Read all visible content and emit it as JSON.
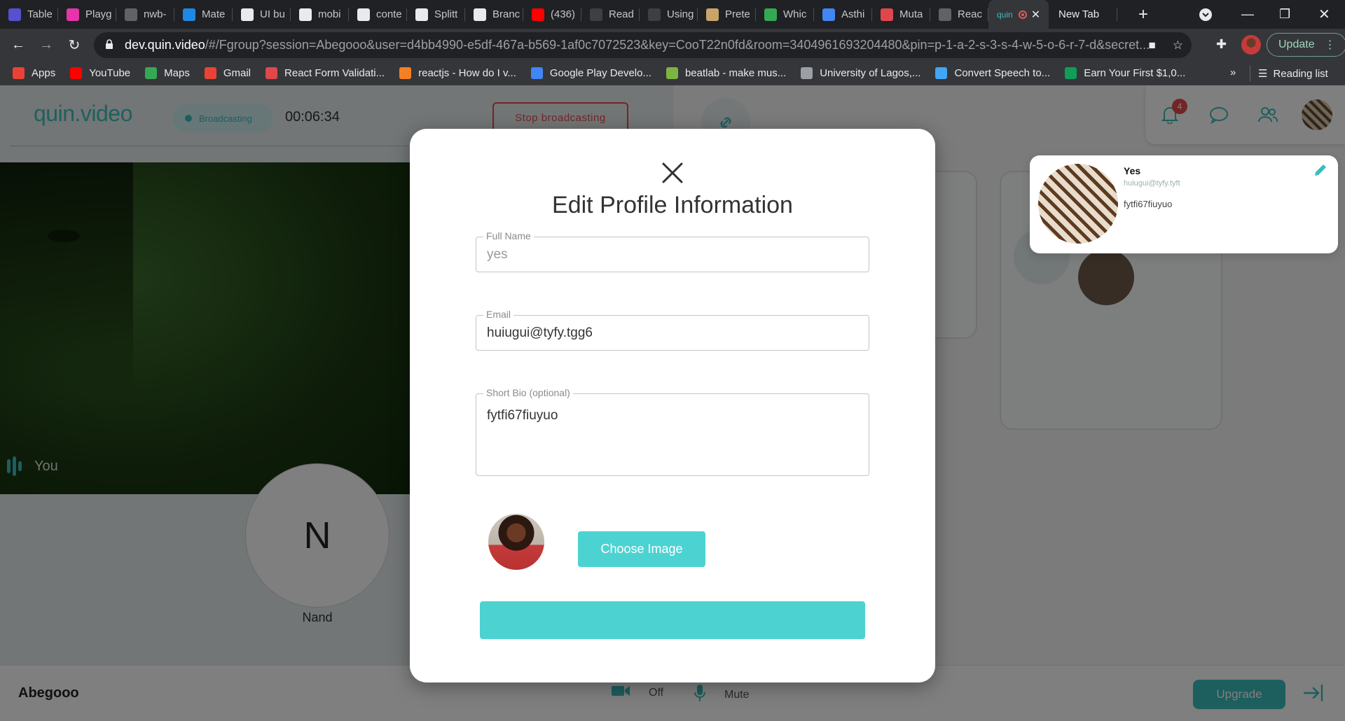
{
  "browser": {
    "tabs": [
      {
        "label": "Table",
        "icon": "audio-wave-icon",
        "color": "#5a4fcf"
      },
      {
        "label": "Playg",
        "icon": "graphql-icon",
        "color": "#e535ab"
      },
      {
        "label": "nwb-",
        "icon": "globe-icon",
        "color": "#5f6368"
      },
      {
        "label": "Mate",
        "icon": "mui-icon",
        "color": "#1e88e5"
      },
      {
        "label": "UI bu",
        "icon": "github-icon",
        "color": "#e8eaed"
      },
      {
        "label": "mobi",
        "icon": "github-icon",
        "color": "#e8eaed"
      },
      {
        "label": "conte",
        "icon": "github-icon",
        "color": "#e8eaed"
      },
      {
        "label": "Splitt",
        "icon": "github-icon",
        "color": "#e8eaed"
      },
      {
        "label": "Branc",
        "icon": "github-icon",
        "color": "#e8eaed"
      },
      {
        "label": "(436)",
        "icon": "youtube-icon",
        "color": "#ff0000"
      },
      {
        "label": "Read",
        "icon": "doc-icon",
        "color": "#3c4043"
      },
      {
        "label": "Using",
        "icon": "doc-icon",
        "color": "#3c4043"
      },
      {
        "label": "Prete",
        "icon": "book-icon",
        "color": "#c8a46b"
      },
      {
        "label": "Whic",
        "icon": "shield-icon",
        "color": "#34a853"
      },
      {
        "label": "Asthi",
        "icon": "dash-icon",
        "color": "#4285f4"
      },
      {
        "label": "Muta",
        "icon": "flower-icon",
        "color": "#e0474c"
      },
      {
        "label": "Reac",
        "icon": "globe-icon",
        "color": "#5f6368"
      }
    ],
    "active_tab": {
      "label": "quin",
      "icon": "quin-icon"
    },
    "new_tab_label": "New Tab",
    "url_host": "dev.quin.video",
    "url_rest": "/#/Fgroup?session=Abegooo&user=d4bb4990-e5df-467a-b569-1af0c7072523&key=CooT22n0fd&room=3404961693204480&pin=p-1-a-2-s-3-s-4-w-5-o-6-r-7-d&secret...",
    "update_label": "Update",
    "bookmarks": [
      {
        "label": "Apps",
        "icon": "apps-grid-icon",
        "color": "#ea4335"
      },
      {
        "label": "YouTube",
        "icon": "youtube-icon",
        "color": "#ff0000"
      },
      {
        "label": "Maps",
        "icon": "maps-icon",
        "color": "#34a853"
      },
      {
        "label": "Gmail",
        "icon": "gmail-icon",
        "color": "#ea4335"
      },
      {
        "label": "React Form Validati...",
        "icon": "bookmark-icon",
        "color": "#e0474c"
      },
      {
        "label": "reactjs - How do I v...",
        "icon": "stackoverflow-icon",
        "color": "#f48024"
      },
      {
        "label": "Google Play Develo...",
        "icon": "play-icon",
        "color": "#4285f4"
      },
      {
        "label": "beatlab - make mus...",
        "icon": "flask-icon",
        "color": "#7cb342"
      },
      {
        "label": "University of Lagos,...",
        "icon": "university-icon",
        "color": "#9aa0a6"
      },
      {
        "label": "Convert Speech to...",
        "icon": "layers-icon",
        "color": "#42a5f5"
      },
      {
        "label": "Earn Your First $1,0...",
        "icon": "sheets-icon",
        "color": "#0f9d58"
      }
    ],
    "bookmarks_overflow": "»",
    "reading_list_label": "Reading list"
  },
  "app": {
    "logo": "quin.video",
    "broadcast_status": "Broadcasting",
    "timer": "00:06:34",
    "stop_label": "Stop broadcasting",
    "self_label": "You",
    "participant_initial": "N",
    "participant_name": "Nand",
    "notification_count": "4",
    "profile_card": {
      "name": "Yes",
      "email": "huiugui@tyfy.tyft",
      "bio": "fytfi67fiuyuo"
    },
    "user_name": "Abegooo",
    "camera_label": "Off",
    "mic_label": "Mute",
    "upgrade_label": "Upgrade",
    "accent_color": "#3bbcbc"
  },
  "modal": {
    "title": "Edit Profile Information",
    "full_name_label": "Full Name",
    "full_name_value": "yes",
    "email_label": "Email",
    "email_value": "huiugui@tyfy.tgg6",
    "bio_label": "Short Bio (optional)",
    "bio_value": "fytfi67fiuyuo",
    "choose_image_label": "Choose Image",
    "button_color": "#4dd2d2"
  }
}
